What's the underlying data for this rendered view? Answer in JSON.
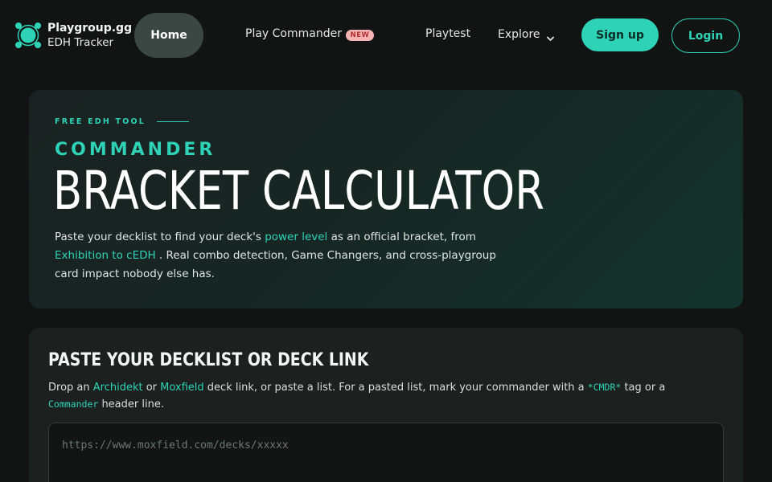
{
  "nav": {
    "brand_name": "Playgroup.gg",
    "brand_sub": "EDH Tracker",
    "home": "Home",
    "play_commander": "Play Commander",
    "new_badge": "NEW",
    "playtest": "Playtest",
    "explore": "Explore",
    "signup": "Sign up",
    "login": "Login"
  },
  "hero": {
    "eyebrow": "FREE EDH TOOL",
    "kicker": "COMMANDER",
    "title": "BRACKET CALCULATOR",
    "desc_1": "Paste your decklist to find your deck's ",
    "desc_link_1": "power level",
    "desc_2": " as an official bracket, from ",
    "desc_link_2": "Exhibition to cEDH",
    "desc_3": " . Real combo detection, Game Changers, and cross-playgroup card impact nobody else has."
  },
  "paste": {
    "title": "PASTE YOUR DECKLIST OR DECK LINK",
    "d1": "Drop an ",
    "archidekt": "Archidekt",
    "d2": " or ",
    "moxfield": "Moxfield",
    "d3": " deck link, or paste a list. For a pasted list, mark your commander with a ",
    "cmdr_tag": "*CMDR*",
    "d4": " tag or a ",
    "commander_code": "Commander",
    "d5": " header line.",
    "placeholder": "https://www.moxfield.com/decks/xxxxx"
  },
  "colors": {
    "accent": "#2ed3b7",
    "background": "#111413",
    "badge_bg": "#f6b3b3",
    "badge_text": "#b0302f"
  },
  "icons": {
    "logo": "playgroup-logo-icon",
    "explore_chevron": "chevron-down-icon"
  }
}
